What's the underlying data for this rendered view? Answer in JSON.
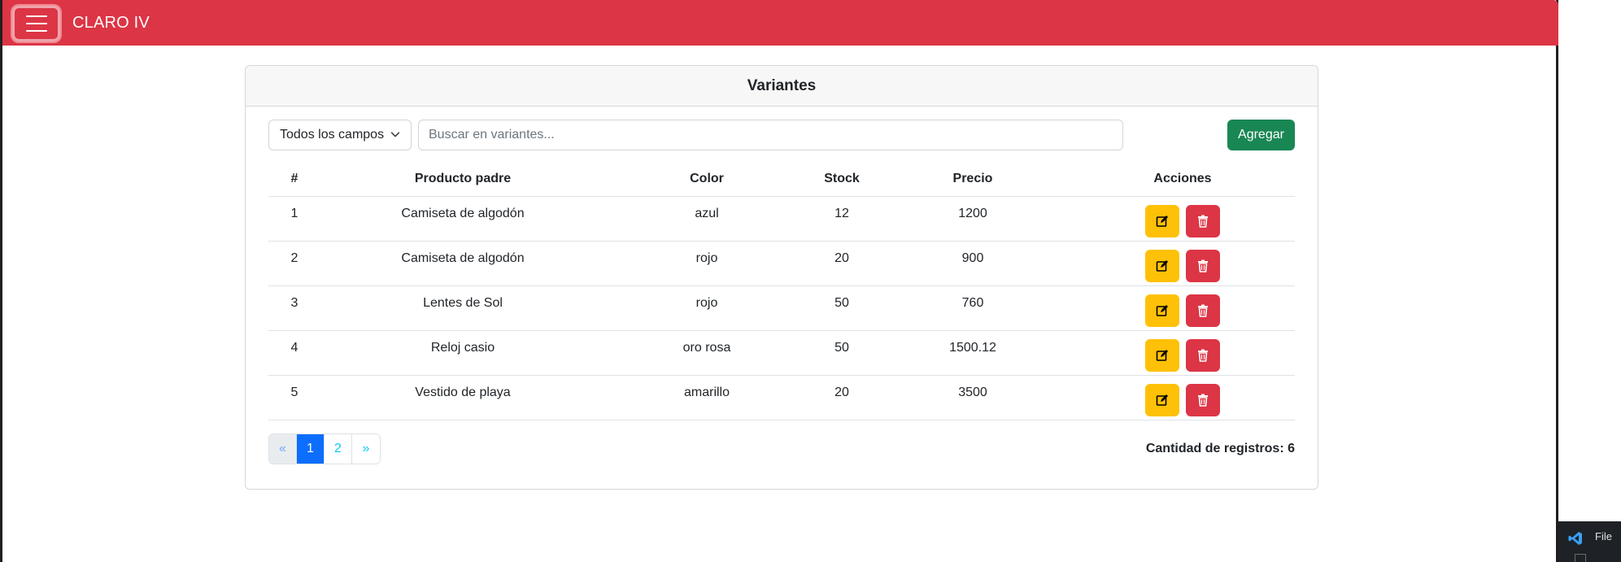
{
  "navbar": {
    "brand": "CLARO IV",
    "color": "#dc3545"
  },
  "card": {
    "title": "Variantes"
  },
  "toolbar": {
    "filter_selected": "Todos los campos",
    "search_placeholder": "Buscar en variantes...",
    "add_label": "Agregar"
  },
  "table": {
    "headers": [
      "#",
      "Producto padre",
      "Color",
      "Stock",
      "Precio",
      "Acciones"
    ],
    "rows": [
      {
        "id": "1",
        "producto": "Camiseta de algodón",
        "color": "azul",
        "stock": "12",
        "precio": "1200"
      },
      {
        "id": "2",
        "producto": "Camiseta de algodón",
        "color": "rojo",
        "stock": "20",
        "precio": "900"
      },
      {
        "id": "3",
        "producto": "Lentes de Sol",
        "color": "rojo",
        "stock": "50",
        "precio": "760"
      },
      {
        "id": "4",
        "producto": "Reloj casio",
        "color": "oro rosa",
        "stock": "50",
        "precio": "1500.12"
      },
      {
        "id": "5",
        "producto": "Vestido de playa",
        "color": "amarillo",
        "stock": "20",
        "precio": "3500"
      }
    ]
  },
  "pagination": {
    "prev": "«",
    "pages": [
      "1",
      "2"
    ],
    "active": "1",
    "next": "»"
  },
  "footer": {
    "count_label": "Cantidad de registros: 6"
  },
  "taskbar": {
    "file_label": "File"
  },
  "colors": {
    "edit": "#ffc107",
    "delete": "#dc3545",
    "add": "#198754",
    "active_page": "#0d6efd"
  }
}
